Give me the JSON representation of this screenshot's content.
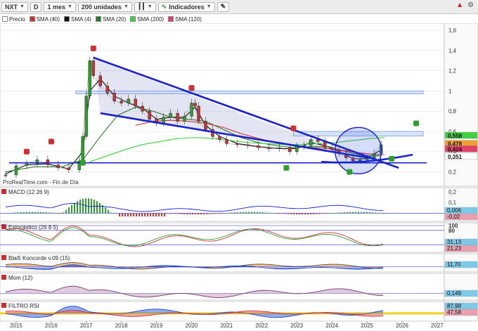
{
  "toolbar": {
    "symbol": "NXT",
    "mode": "D",
    "period": "1 mes",
    "units": "200 unidades",
    "indicators": "Indicadores"
  },
  "legend": [
    {
      "label": "Precio",
      "color": "#ffffff"
    },
    {
      "label": "SMA (40)",
      "color": "#d03030"
    },
    {
      "label": "SMA (4)",
      "color": "#111111"
    },
    {
      "label": "SMA (20)",
      "color": "#2a7a2a"
    },
    {
      "label": "SMA (200)",
      "color": "#40d040"
    },
    {
      "label": "SMA (120)",
      "color": "#e0406a"
    }
  ],
  "source_label": "ProRealTime.com - Fin de Día",
  "chart_data": [
    {
      "type": "line",
      "title": "NXT",
      "x_years": [
        "2015",
        "2016",
        "2017",
        "2018",
        "2019",
        "2020",
        "2021",
        "2022",
        "2023",
        "2024",
        "2025",
        "2026",
        "2027"
      ],
      "ylim": [
        0.1,
        1.6
      ],
      "y_ticks": [
        "1,6",
        "1,4",
        "1,2",
        "1",
        "0,8",
        "0,6",
        "0,4",
        "0,2"
      ],
      "price_series": {
        "name": "Precio",
        "x": [
          2014.7,
          2015.0,
          2015.3,
          2015.6,
          2015.9,
          2016.2,
          2016.5,
          2016.8,
          2016.9,
          2017.0,
          2017.1,
          2017.2,
          2017.4,
          2017.6,
          2017.8,
          2018.0,
          2018.2,
          2018.4,
          2018.6,
          2018.8,
          2019.0,
          2019.2,
          2019.4,
          2019.6,
          2019.8,
          2020.0,
          2020.1,
          2020.2,
          2020.4,
          2020.6,
          2020.8,
          2021.0,
          2021.3,
          2021.6,
          2021.9,
          2022.2,
          2022.5,
          2022.8,
          2023.0,
          2023.2,
          2023.4,
          2023.6,
          2023.8,
          2024.0,
          2024.2,
          2024.4,
          2024.6,
          2024.8,
          2025.0,
          2025.2,
          2025.4
        ],
        "y": [
          0.17,
          0.26,
          0.28,
          0.32,
          0.27,
          0.24,
          0.22,
          0.3,
          0.55,
          0.95,
          1.3,
          1.15,
          1.05,
          0.98,
          0.9,
          0.88,
          0.92,
          0.85,
          0.8,
          0.72,
          0.68,
          0.74,
          0.78,
          0.7,
          0.75,
          0.88,
          0.85,
          0.7,
          0.62,
          0.55,
          0.52,
          0.48,
          0.47,
          0.46,
          0.44,
          0.43,
          0.44,
          0.4,
          0.45,
          0.46,
          0.52,
          0.5,
          0.44,
          0.42,
          0.38,
          0.34,
          0.31,
          0.32,
          0.33,
          0.38,
          0.47
        ]
      },
      "sma_series": [
        {
          "name": "SMA (4)",
          "color": "#111111",
          "x": [
            2014.7,
            2015.3,
            2015.9,
            2016.5,
            2016.9,
            2017.1,
            2017.4,
            2017.8,
            2018.2,
            2018.6,
            2019.0,
            2019.4,
            2019.8,
            2020.1,
            2020.4,
            2020.8,
            2021.3,
            2021.9,
            2022.5,
            2023.0,
            2023.4,
            2023.8,
            2024.2,
            2024.6,
            2025.0,
            2025.4
          ],
          "y": [
            0.18,
            0.27,
            0.28,
            0.23,
            0.4,
            1.0,
            1.12,
            0.95,
            0.88,
            0.83,
            0.72,
            0.74,
            0.74,
            0.84,
            0.66,
            0.55,
            0.48,
            0.45,
            0.43,
            0.43,
            0.49,
            0.46,
            0.4,
            0.33,
            0.33,
            0.42
          ]
        },
        {
          "name": "SMA (20)",
          "color": "#2a7a2a",
          "x": [
            2014.7,
            2015.5,
            2016.3,
            2016.9,
            2017.4,
            2017.9,
            2018.4,
            2018.9,
            2019.4,
            2019.9,
            2020.4,
            2020.9,
            2021.4,
            2021.9,
            2022.4,
            2022.9,
            2023.4,
            2023.9,
            2024.4,
            2024.9,
            2025.4
          ],
          "y": [
            0.2,
            0.25,
            0.25,
            0.32,
            0.55,
            0.76,
            0.84,
            0.8,
            0.74,
            0.72,
            0.7,
            0.62,
            0.54,
            0.49,
            0.46,
            0.44,
            0.45,
            0.45,
            0.4,
            0.36,
            0.36
          ]
        },
        {
          "name": "SMA (40)",
          "color": "#d03030",
          "x": [
            2018.4,
            2018.9,
            2019.4,
            2019.9,
            2020.4,
            2020.9,
            2021.4,
            2021.9,
            2022.4,
            2022.9,
            2023.4,
            2023.9,
            2024.4,
            2024.9,
            2025.4
          ],
          "y": [
            0.66,
            0.7,
            0.71,
            0.7,
            0.68,
            0.64,
            0.58,
            0.53,
            0.49,
            0.46,
            0.44,
            0.43,
            0.41,
            0.38,
            0.37
          ]
        },
        {
          "name": "SMA (200)",
          "color": "#40d040",
          "x": [
            2017.1,
            2017.6,
            2018.1,
            2018.6,
            2019.1,
            2019.6,
            2020.1,
            2020.6,
            2021.1,
            2021.6,
            2022.1,
            2022.6,
            2023.1,
            2023.6,
            2024.1,
            2024.6,
            2025.1,
            2025.5
          ],
          "y": [
            0.3,
            0.36,
            0.42,
            0.47,
            0.5,
            0.53,
            0.54,
            0.53,
            0.51,
            0.49,
            0.48,
            0.47,
            0.47,
            0.48,
            0.49,
            0.51,
            0.53,
            0.54
          ]
        },
        {
          "name": "SMA (120)",
          "color": "#e0406a",
          "x": [
            2024.0,
            2024.5,
            2025.0,
            2025.5
          ],
          "y": [
            0.42,
            0.4,
            0.38,
            0.37
          ]
        }
      ],
      "price_labels": [
        {
          "text": "0,558",
          "value": 0.558,
          "color": "#40d040"
        },
        {
          "text": "0,478",
          "value": 0.478,
          "color": "#f0a030"
        },
        {
          "text": "0,424",
          "value": 0.424,
          "color": "#e0406a"
        },
        {
          "text": "0,351",
          "value": 0.351,
          "color": "#ffffff"
        }
      ]
    },
    {
      "type": "bar",
      "title": "MACD (12 26 9)",
      "ylim": [
        -0.05,
        0.2
      ],
      "y_ticks": [
        "0,2",
        "0,1"
      ],
      "value_labels": [
        "0,006",
        "-0,02"
      ]
    },
    {
      "type": "line",
      "title": "Estocástico (26 8 5)",
      "ylim": [
        0,
        100
      ],
      "y_ticks": [
        "100",
        "80"
      ],
      "value_labels": [
        "31,13",
        "21,23"
      ]
    },
    {
      "type": "area",
      "title": "Blai5 Koncorde v.09 (15)",
      "value_labels": [
        "11,70"
      ]
    },
    {
      "type": "area",
      "title": "Mom (12)",
      "value_labels": [
        "0,149"
      ]
    },
    {
      "type": "area",
      "title": "FILTRO RSI",
      "value_labels": [
        "87,98",
        "47,58"
      ]
    }
  ]
}
